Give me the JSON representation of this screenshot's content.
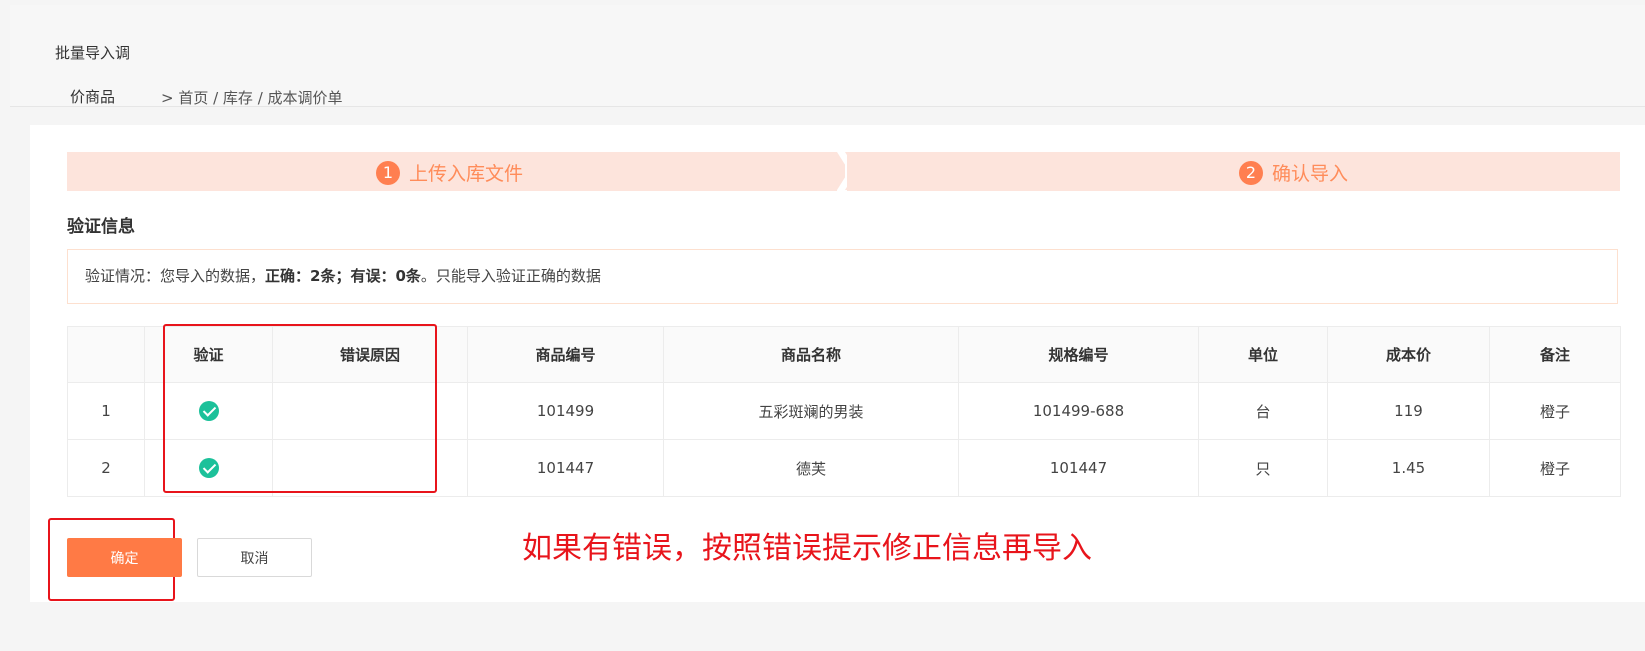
{
  "header": {
    "title_line1": "批量导入调",
    "title_line2": "价商品",
    "breadcrumb": "> 首页 / 库存 / 成本调价单"
  },
  "steps": [
    {
      "num": "1",
      "label": "上传入库文件"
    },
    {
      "num": "2",
      "label": "确认导入"
    }
  ],
  "section_title": "验证信息",
  "notice": {
    "prefix": "验证情况：您导入的数据，",
    "correct_label": "正确：2条；",
    "error_label": "有误：0条",
    "suffix": "。只能导入验证正确的数据"
  },
  "table": {
    "headers": [
      "",
      "验证",
      "错误原因",
      "商品编号",
      "商品名称",
      "规格编号",
      "单位",
      "成本价",
      "备注"
    ],
    "rows": [
      {
        "index": "1",
        "valid": "check-circle-icon",
        "error": "",
        "code": "101499",
        "name": "五彩斑斓的男装",
        "spec": "101499-688",
        "unit": "台",
        "cost": "119",
        "note": "橙子"
      },
      {
        "index": "2",
        "valid": "check-circle-icon",
        "error": "",
        "code": "101447",
        "name": "德芙",
        "spec": "101447",
        "unit": "只",
        "cost": "1.45",
        "note": "橙子"
      }
    ]
  },
  "annotation": "如果有错误，按照错误提示修正信息再导入",
  "buttons": {
    "confirm": "确定",
    "cancel": "取消"
  },
  "colors": {
    "accent": "#ff7a45",
    "step_bg": "#fde4dc",
    "success": "#1cc19a",
    "annotation_red": "#e8141b"
  }
}
